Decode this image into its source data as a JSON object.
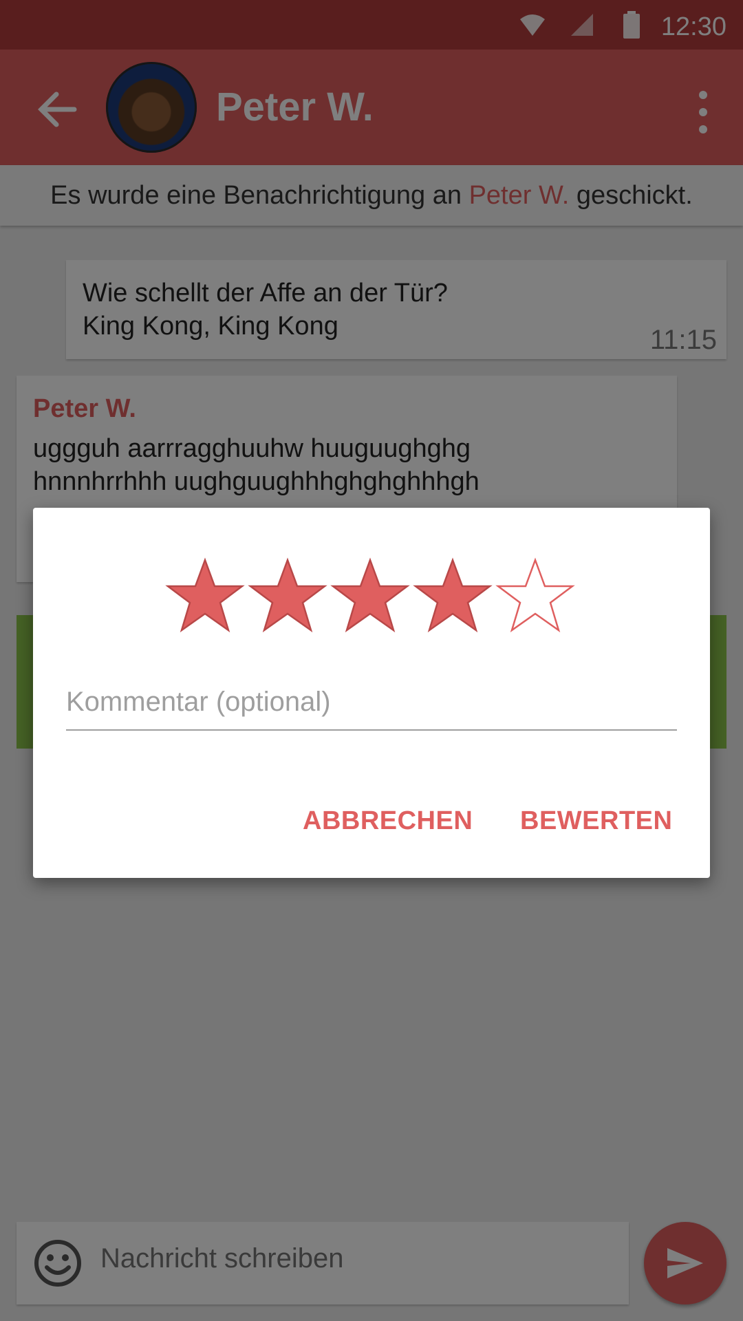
{
  "status_bar": {
    "time": "12:30"
  },
  "app_bar": {
    "contact_name": "Peter W."
  },
  "notice": {
    "prefix": "Es wurde eine Benachrichtigung an ",
    "name": "Peter W.",
    "suffix": " geschickt."
  },
  "messages": {
    "outgoing": {
      "line1": "Wie schellt der Affe an der Tür?",
      "line2": "King Kong, King Kong",
      "time": "11:15"
    },
    "incoming": {
      "sender": "Peter W.",
      "line1": "uggguh aarrragghuuhw huuguughghg",
      "line2": "hnnnhrrhhh uughguughhhghghghhhgh"
    }
  },
  "compose": {
    "placeholder": "Nachricht schreiben"
  },
  "dialog": {
    "rating": 4,
    "max_rating": 5,
    "comment_placeholder": "Kommentar (optional)",
    "cancel_label": "ABBRECHEN",
    "rate_label": "BEWERTEN"
  },
  "colors": {
    "accent": "#df5f5f",
    "status_bar": "#b23c3c",
    "positive": "#8bc34a"
  }
}
